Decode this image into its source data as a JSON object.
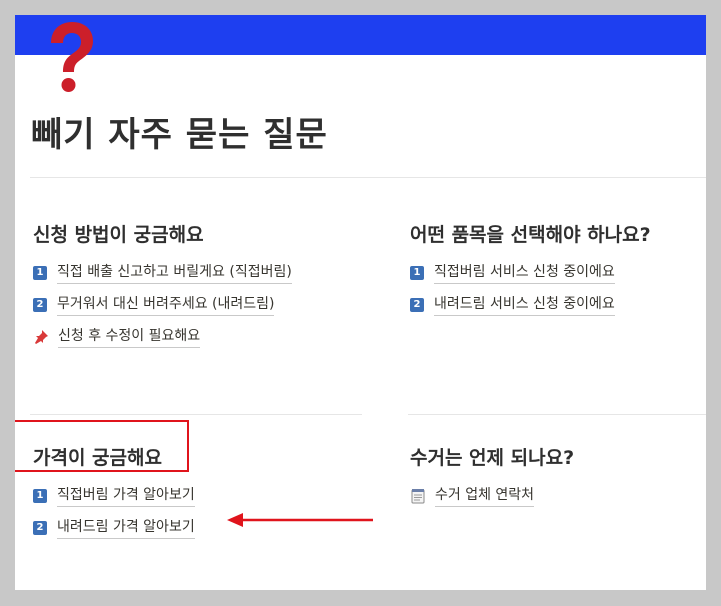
{
  "page": {
    "title": "빼기 자주 묻는 질문",
    "icon": "question-mark-icon",
    "cover_color": "#1e3ff0"
  },
  "sections": [
    {
      "heading": "신청 방법이 궁금해요",
      "items": [
        {
          "badge": "1",
          "label": "직접 배출 신고하고 버릴게요 (직접버림)"
        },
        {
          "badge": "2",
          "label": "무거워서 대신 버려주세요 (내려드림)"
        },
        {
          "icon": "pushpin-icon",
          "label": "신청 후 수정이 필요해요"
        }
      ]
    },
    {
      "heading": "어떤 품목을 선택해야 하나요?",
      "items": [
        {
          "badge": "1",
          "label": "직접버림 서비스 신청 중이에요"
        },
        {
          "badge": "2",
          "label": "내려드림 서비스 신청 중이에요"
        }
      ]
    },
    {
      "heading": "가격이 궁금해요",
      "items": [
        {
          "badge": "1",
          "label": "직접버림 가격 알아보기"
        },
        {
          "badge": "2",
          "label": "내려드림 가격 알아보기"
        }
      ]
    },
    {
      "heading": "수거는 언제 되나요?",
      "items": [
        {
          "icon": "notepad-icon",
          "label": "수거 업체 연락처"
        }
      ]
    }
  ],
  "annotation_color": "#e0141c"
}
